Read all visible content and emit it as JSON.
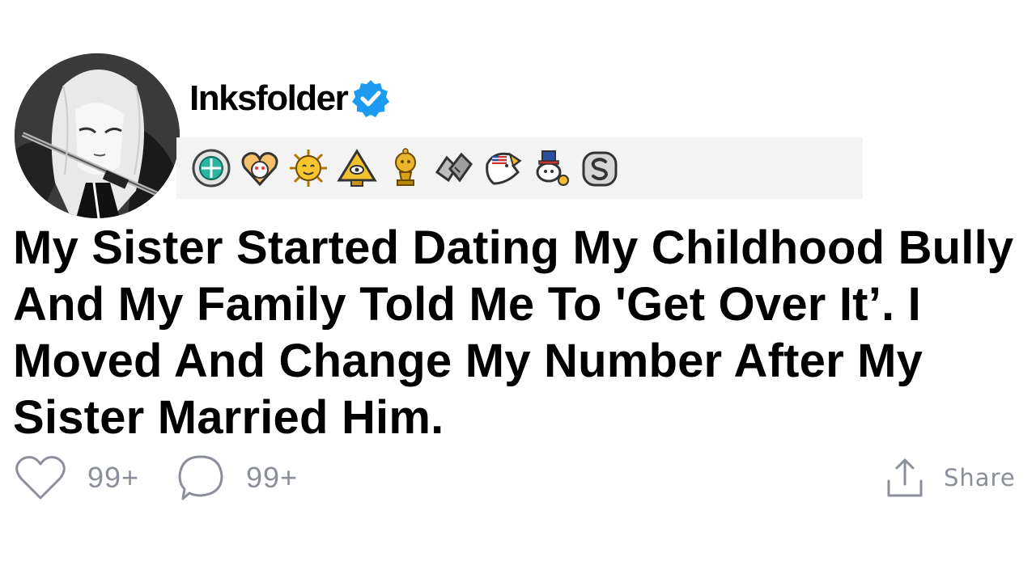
{
  "post": {
    "author": {
      "username": "Inksfolder",
      "verified": true,
      "avatar_icon": "anime-girl-with-sword-avatar"
    },
    "awards": [
      {
        "icon": "teal-gem-award-icon"
      },
      {
        "icon": "heart-snoo-award-icon"
      },
      {
        "icon": "sun-award-icon"
      },
      {
        "icon": "pyramid-eye-award-icon"
      },
      {
        "icon": "gold-snoo-trophy-award-icon"
      },
      {
        "icon": "handshake-award-icon"
      },
      {
        "icon": "eagle-flag-award-icon"
      },
      {
        "icon": "snoo-uncle-sam-award-icon"
      },
      {
        "icon": "silver-s-coin-award-icon"
      }
    ],
    "title": "My Sister Started Dating My Childhood Bully And My Family Told Me To 'Get Over It’. I Moved And Change My Number After My Sister Married Him.",
    "likes": "99+",
    "comments": "99+",
    "share_label": "Share"
  },
  "colors": {
    "verified_blue": "#1d9bf0",
    "meta_gray": "#8a8f99",
    "awards_bg": "#f3f3f3"
  }
}
